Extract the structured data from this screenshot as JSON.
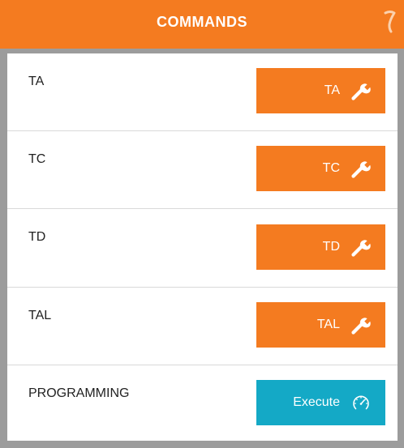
{
  "header": {
    "title": "COMMANDS",
    "icon": "hook-icon",
    "color": "#f47b20"
  },
  "rows": [
    {
      "label": "TA",
      "button_label": "TA",
      "button_icon": "wrench-icon"
    },
    {
      "label": "TC",
      "button_label": "TC",
      "button_icon": "wrench-icon"
    },
    {
      "label": "TD",
      "button_label": "TD",
      "button_icon": "wrench-icon"
    },
    {
      "label": "TAL",
      "button_label": "TAL",
      "button_icon": "wrench-icon"
    },
    {
      "label": "PROGRAMMING",
      "button_label": "Execute",
      "button_icon": "speedometer-icon"
    }
  ],
  "colors": {
    "accent": "#f47b20",
    "execute": "#14a9c6",
    "background": "#9c9c9c"
  }
}
